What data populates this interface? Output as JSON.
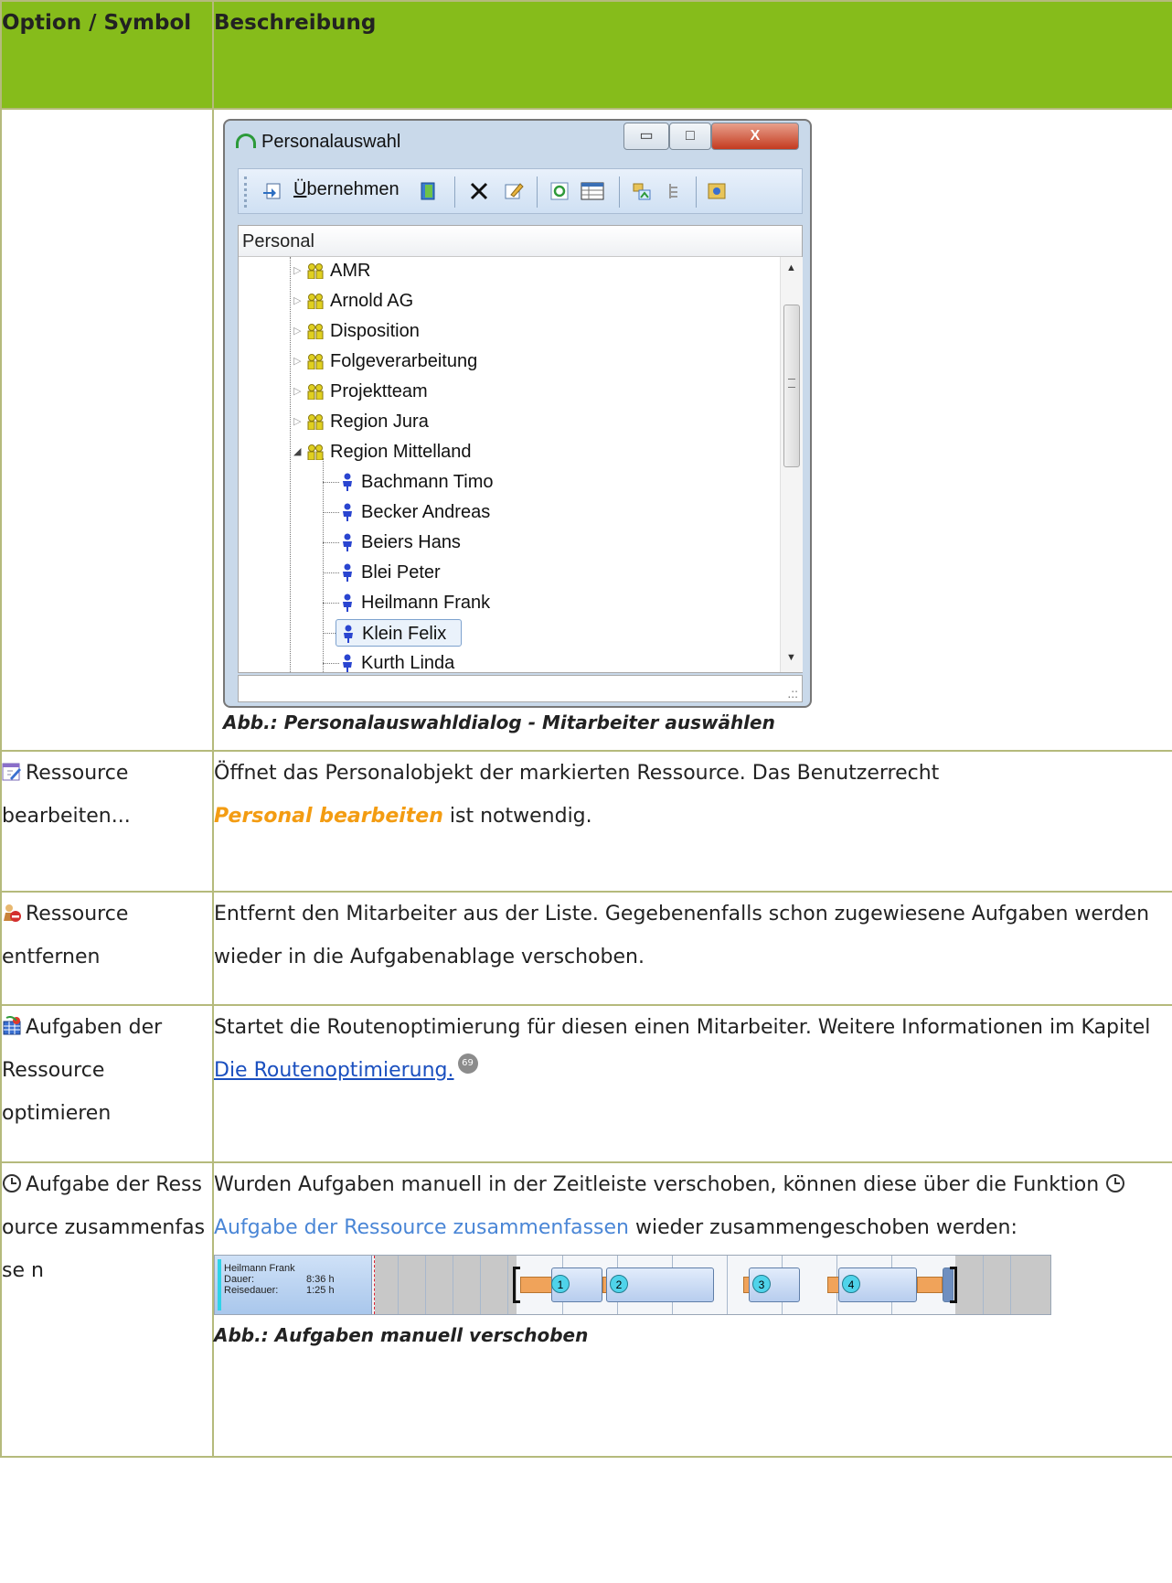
{
  "header": {
    "col1": "Option / Symbol",
    "col2": "Beschreibung"
  },
  "dialog": {
    "title": "Personalauswahl",
    "min_btn": "▭",
    "max_btn": "□",
    "close_btn": "X",
    "toolbar_accept_underlined": "Ü",
    "toolbar_accept_rest": "bernehmen",
    "list_header": "Personal",
    "groups": [
      "AMR",
      "Arnold AG",
      "Disposition",
      "Folgeverarbeitung",
      "Projektteam",
      "Region Jura",
      "Region Mittelland"
    ],
    "persons": [
      "Bachmann Timo",
      "Becker Andreas",
      "Beiers Hans",
      "Blei Peter",
      "Heilmann Frank",
      "Klein Felix",
      "Kurth Linda"
    ],
    "selected_person": "Klein Felix",
    "resize_grip": ".::"
  },
  "caption1": "Abb.: Personalauswahldialog - Mitarbeiter auswählen",
  "rows": [
    {
      "option": "Ressource bearbeiten...",
      "icon": "edit-resource-icon",
      "desc_a": "Öffnet das Personalobjekt der markierten Ressource. Das Benutzerrecht",
      "desc_kw": "Personal bearbeiten",
      "desc_b": "ist notwendig."
    },
    {
      "option": "Ressource entfernen",
      "icon": "remove-resource-icon",
      "desc": "Entfernt den Mitarbeiter aus der Liste. Gegebenenfalls schon zugewiesene Aufgaben werden wieder in die Aufgabenablage verschoben."
    },
    {
      "option": "Aufgaben der Ressource optimieren",
      "icon": "optimize-icon",
      "desc": "Startet die Routenoptimierung für diesen einen Mitarbeiter. Weitere Informationen im Kapitel",
      "link": "Die Routenoptimierung.",
      "page_ref": "69"
    },
    {
      "option": "Aufgabe der Ressource zusammenfasse n",
      "icon": "clock-icon",
      "desc_a": "Wurden Aufgaben manuell in der Zeitleiste verschoben, können diese über die Funktion",
      "desc_fn": "Aufgabe der Ressource zusammenfassen",
      "desc_b": "wieder zusammengeschoben werden:"
    }
  ],
  "timeline": {
    "name": "Heilmann Frank",
    "dauer_label": "Dauer:",
    "dauer": "8:36 h",
    "reise_label": "Reisedauer:",
    "reise": "1:25 h",
    "tasks": [
      "1",
      "2",
      "3",
      "4"
    ]
  },
  "caption2": "Abb.: Aufgaben manuell verschoben",
  "colors": {
    "header_green": "#86bc1b",
    "keyword_orange": "#f39c12",
    "link_blue": "#1a4fbf",
    "function_blue": "#4a86d6"
  }
}
